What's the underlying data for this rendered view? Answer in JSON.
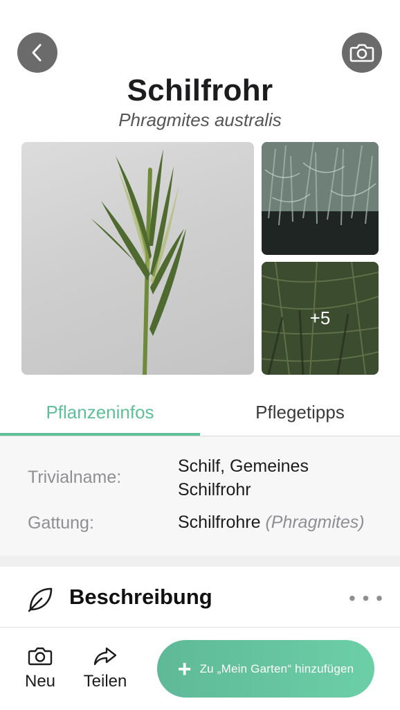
{
  "header": {
    "title": "Schilfrohr",
    "subtitle": "Phragmites australis",
    "back_icon": "chevron-left-icon",
    "camera_icon": "camera-icon"
  },
  "gallery": {
    "more_count": "+5"
  },
  "tabs": [
    {
      "label": "Pflanzeninfos",
      "active": true
    },
    {
      "label": "Pflegetipps",
      "active": false
    }
  ],
  "info": {
    "common_name_label": "Trivialname:",
    "common_name_line1": "Schilf, Gemeines",
    "common_name_line2": "Schilfrohr",
    "genus_label": "Gattung:",
    "genus_value": "Schilfrohre",
    "genus_latin": "(Phragmites)"
  },
  "section": {
    "title": "Beschreibung",
    "icon": "leaf-icon",
    "more": "• • •"
  },
  "bottom_bar": {
    "new_label": "Neu",
    "share_label": "Teilen",
    "add_label": "Zu „Mein Garten“ hinzufügen",
    "add_plus": "+"
  },
  "colors": {
    "accent": "#5fbf98",
    "button_gradient_start": "#5fb998",
    "button_gradient_end": "#6ccfa7",
    "circle_button": "#6b6b6b"
  }
}
